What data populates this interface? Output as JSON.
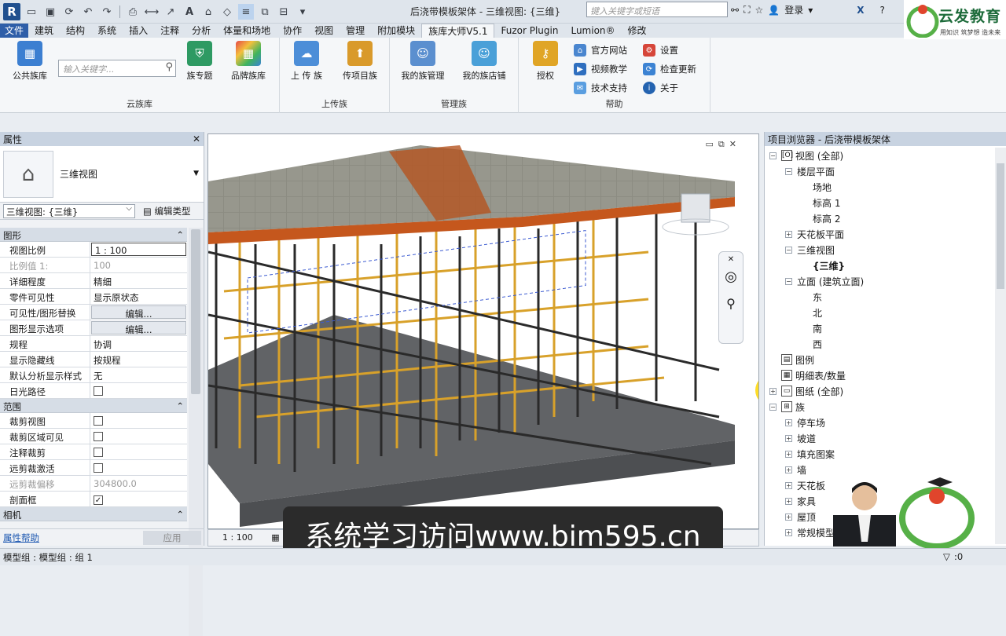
{
  "window": {
    "title": "后浇带模板架体 - 三维视图: {三维}",
    "search_placeholder": "键入关键字或短语",
    "login": "登录",
    "help": "?"
  },
  "ribbon_tabs": [
    "文件",
    "建筑",
    "结构",
    "系统",
    "插入",
    "注释",
    "分析",
    "体量和场地",
    "协作",
    "视图",
    "管理",
    "附加模块",
    "族库大师V5.1",
    "Fuzor Plugin",
    "Lumion®",
    "修改"
  ],
  "active_tab": "族库大师V5.1",
  "ribbon": {
    "search_placeholder": "输入关键字...",
    "groups": [
      {
        "label": "云族库",
        "buttons": [
          "公共族库",
          "族专题",
          "品牌族库"
        ]
      },
      {
        "label": "上传族",
        "buttons": [
          "上 传 族",
          "传项目族"
        ]
      },
      {
        "label": "管理族",
        "buttons": [
          "我的族管理",
          "我的族店铺"
        ]
      },
      {
        "label": "帮助",
        "buttons": [
          "授权"
        ],
        "small": [
          "官方网站",
          "视频教学",
          "技术支持",
          "设置",
          "检查更新",
          "关于"
        ]
      }
    ]
  },
  "brand": {
    "name": "云发教育",
    "slogan": "用知识 筑梦想 造未来"
  },
  "properties": {
    "title": "属性",
    "type_name": "三维视图",
    "selector": "三维视图: {三维}",
    "edit_type": "编辑类型",
    "sections": [
      {
        "name": "图形",
        "rows": [
          {
            "k": "视图比例",
            "v": "1 : 100",
            "kind": "input"
          },
          {
            "k": "比例值 1:",
            "v": "100",
            "kind": "dim"
          },
          {
            "k": "详细程度",
            "v": "精细"
          },
          {
            "k": "零件可见性",
            "v": "显示原状态"
          },
          {
            "k": "可见性/图形替换",
            "v": "编辑...",
            "kind": "button"
          },
          {
            "k": "图形显示选项",
            "v": "编辑...",
            "kind": "button"
          },
          {
            "k": "规程",
            "v": "协调"
          },
          {
            "k": "显示隐藏线",
            "v": "按规程"
          },
          {
            "k": "默认分析显示样式",
            "v": "无"
          },
          {
            "k": "日光路径",
            "v": "",
            "kind": "checkbox",
            "checked": false
          }
        ]
      },
      {
        "name": "范围",
        "rows": [
          {
            "k": "裁剪视图",
            "v": "",
            "kind": "checkbox",
            "checked": false
          },
          {
            "k": "裁剪区域可见",
            "v": "",
            "kind": "checkbox",
            "checked": false
          },
          {
            "k": "注释裁剪",
            "v": "",
            "kind": "checkbox",
            "checked": false
          },
          {
            "k": "远剪裁激活",
            "v": "",
            "kind": "checkbox",
            "checked": false
          },
          {
            "k": "远剪裁偏移",
            "v": "304800.0",
            "kind": "dim"
          },
          {
            "k": "剖面框",
            "v": "",
            "kind": "checkbox",
            "checked": true
          }
        ]
      },
      {
        "name": "相机",
        "rows": []
      }
    ],
    "help_link": "属性帮助",
    "apply": "应用"
  },
  "viewport": {
    "scale": "1 : 100"
  },
  "browser": {
    "title": "项目浏览器 - 后浇带模板架体",
    "nodes": [
      {
        "label": "视图 (全部)",
        "level": 0,
        "ex": "-",
        "icon": "[O]"
      },
      {
        "label": "楼层平面",
        "level": 1,
        "ex": "-"
      },
      {
        "label": "场地",
        "level": 2
      },
      {
        "label": "标高 1",
        "level": 2
      },
      {
        "label": "标高 2",
        "level": 2
      },
      {
        "label": "天花板平面",
        "level": 1,
        "ex": "+"
      },
      {
        "label": "三维视图",
        "level": 1,
        "ex": "-"
      },
      {
        "label": "{三维}",
        "level": 2,
        "bold": true
      },
      {
        "label": "立面 (建筑立面)",
        "level": 1,
        "ex": "-"
      },
      {
        "label": "东",
        "level": 2
      },
      {
        "label": "北",
        "level": 2
      },
      {
        "label": "南",
        "level": 2
      },
      {
        "label": "西",
        "level": 2
      },
      {
        "label": "图例",
        "level": 0,
        "icon": "▤"
      },
      {
        "label": "明细表/数量",
        "level": 0,
        "icon": "▦"
      },
      {
        "label": "图纸 (全部)",
        "level": 0,
        "ex": "+",
        "icon": "▭"
      },
      {
        "label": "族",
        "level": 0,
        "ex": "-",
        "icon": "⊞"
      },
      {
        "label": "停车场",
        "level": 1,
        "ex": "+"
      },
      {
        "label": "坡道",
        "level": 1,
        "ex": "+"
      },
      {
        "label": "填充图案",
        "level": 1,
        "ex": "+"
      },
      {
        "label": "墙",
        "level": 1,
        "ex": "+"
      },
      {
        "label": "天花板",
        "level": 1,
        "ex": "+"
      },
      {
        "label": "家具",
        "level": 1,
        "ex": "+"
      },
      {
        "label": "屋顶",
        "level": 1,
        "ex": "+"
      },
      {
        "label": "常规模型",
        "level": 1,
        "ex": "+"
      }
    ]
  },
  "status": {
    "left": "模型组 : 模型组 : 组 1",
    "count": ":0",
    "filter": ":0"
  },
  "subtitle": "系统学习访问www.bim595.cn"
}
